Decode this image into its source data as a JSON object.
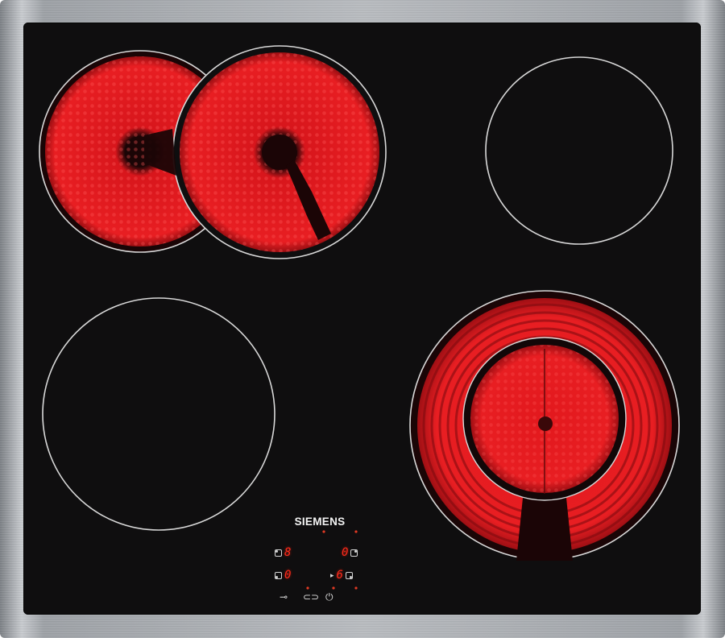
{
  "image": {
    "subject": "Siemens ceramic electric hob, top view",
    "colors": {
      "glass": "#0f0e0f",
      "frame": "#b9bcc0",
      "heat_red": "#e81e22",
      "zone_outline": "#d8d8d8"
    }
  },
  "brand": {
    "text": "SIEMENS"
  },
  "top_mark": {
    "text": ""
  },
  "badge": {
    "text": "",
    "sub": ""
  },
  "zone_tag": {
    "text": ""
  },
  "zones": [
    {
      "id": "front-left-dual",
      "state": "hot"
    },
    {
      "id": "back-right",
      "state": "off"
    },
    {
      "id": "back-left",
      "state": "off"
    },
    {
      "id": "front-right-dual",
      "state": "hot"
    }
  ],
  "controls": {
    "zone_left_top": {
      "icon": "zone-top-left-icon",
      "digit": "8"
    },
    "zone_right_top": {
      "icon": "zone-top-right-icon",
      "digit": "0"
    },
    "zone_left_bottom": {
      "icon": "zone-bottom-left-icon",
      "digit": "0"
    },
    "zone_right_bottom": {
      "icon": "zone-bottom-right-icon",
      "digit": "6"
    },
    "bottom_icons": [
      {
        "name": "key-lock-icon",
        "glyph": "⊸"
      },
      {
        "name": "dual-zone-icon",
        "glyph": "⊂⊃"
      },
      {
        "name": "power-icon",
        "glyph": "⏻"
      }
    ]
  }
}
